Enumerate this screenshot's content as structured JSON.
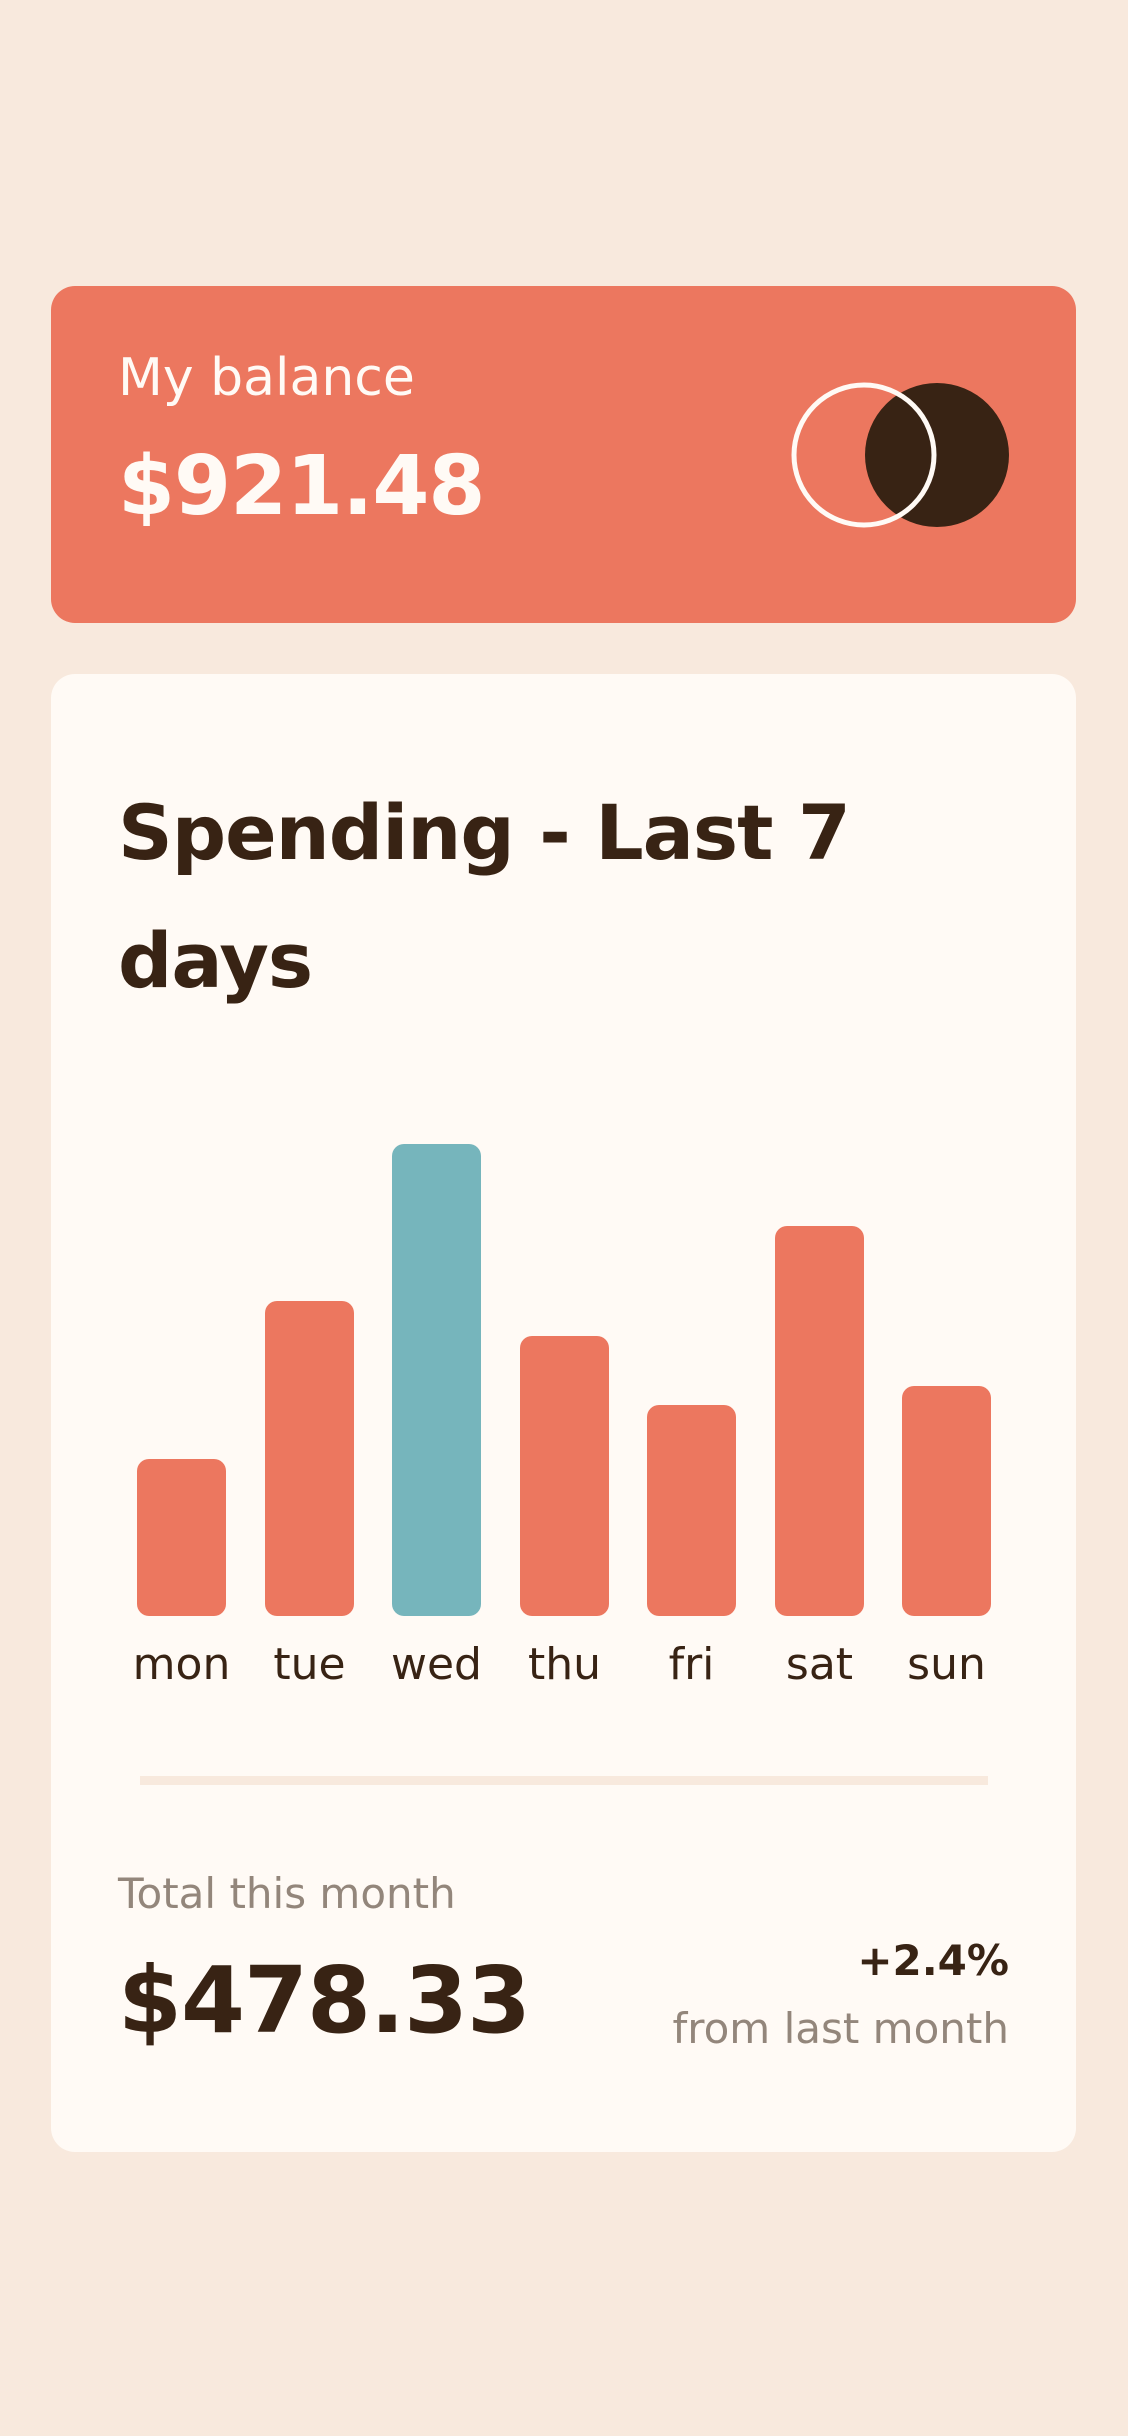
{
  "balance": {
    "label": "My balance",
    "amount": "$921.48"
  },
  "spending": {
    "title": "Spending - Last 7 days",
    "total_label": "Total this month",
    "total_amount": "$478.33",
    "change_percent": "+2.4%",
    "change_label": "from last month"
  },
  "colors": {
    "background": "#f8e9dd",
    "card": "#fffaf5",
    "accent": "#ec775f",
    "highlight": "#76b5bc",
    "text_dark": "#382314",
    "text_muted": "#93867b"
  },
  "chart_data": {
    "type": "bar",
    "categories": [
      "mon",
      "tue",
      "wed",
      "thu",
      "fri",
      "sat",
      "sun"
    ],
    "values": [
      17.45,
      34.91,
      52.36,
      31.07,
      23.39,
      43.28,
      25.48
    ],
    "highlight_index": 2
  }
}
